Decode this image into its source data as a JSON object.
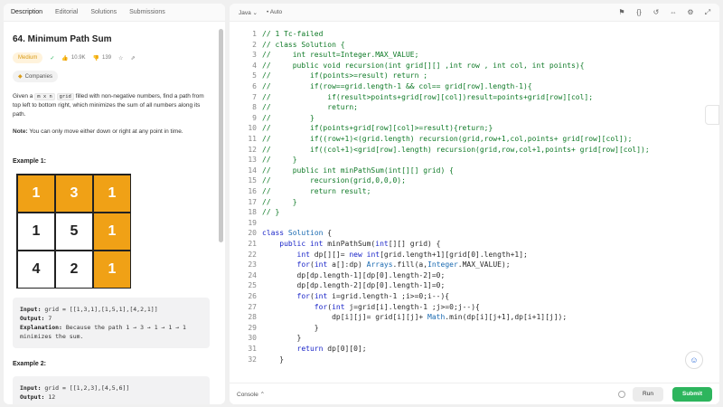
{
  "left_tabs": [
    "Description",
    "Editorial",
    "Solutions",
    "Submissions"
  ],
  "problem": {
    "title": "64. Minimum Path Sum",
    "difficulty": "Medium",
    "difficulty_color": "#d99b18",
    "likes": "10.9K",
    "dislikes": "139",
    "companies": "Companies",
    "desc_prefix": "Given a",
    "desc_code": "m x n",
    "desc_code2": "grid",
    "desc_rest": "filled with non-negative numbers, find a path from top left to bottom right, which minimizes the sum of all numbers along its path.",
    "note_label": "Note:",
    "note_text": "You can only move either down or right at any point in time."
  },
  "example1": {
    "label": "Example 1:",
    "grid": [
      [
        "1",
        "3",
        "1"
      ],
      [
        "1",
        "5",
        "1"
      ],
      [
        "4",
        "2",
        "1"
      ]
    ],
    "path_color": "#f0a116",
    "input_label": "Input:",
    "input_value": "grid = [[1,3,1],[1,5,1],[4,2,1]]",
    "output_label": "Output:",
    "output_value": "7",
    "explanation_label": "Explanation:",
    "explanation_value": "Because the path 1 → 3 → 1 → 1 → 1 minimizes the sum."
  },
  "example2": {
    "label": "Example 2:",
    "input_label": "Input:",
    "input_value": "grid = [[1,2,3],[4,5,6]]",
    "output_label": "Output:",
    "output_value": "12"
  },
  "editor": {
    "language": "Java",
    "autocomplete": "Auto",
    "lines": [
      {
        "n": "1",
        "t": "// 1 Tc-failed",
        "c": "cm"
      },
      {
        "n": "2",
        "t": "// class Solution {",
        "c": "cm"
      },
      {
        "n": "3",
        "t": "//     int result=Integer.MAX_VALUE;",
        "c": "cm"
      },
      {
        "n": "4",
        "t": "//     public void recursion(int grid[][] ,int row , int col, int points){",
        "c": "cm"
      },
      {
        "n": "5",
        "t": "//         if(points>=result) return ;",
        "c": "cm"
      },
      {
        "n": "6",
        "t": "//         if(row==grid.length-1 && col== grid[row].length-1){",
        "c": "cm"
      },
      {
        "n": "7",
        "t": "//             if(result>points+grid[row][col])result=points+grid[row][col];",
        "c": "cm"
      },
      {
        "n": "8",
        "t": "//             return;",
        "c": "cm"
      },
      {
        "n": "9",
        "t": "//         }",
        "c": "cm"
      },
      {
        "n": "10",
        "t": "//         if(points+grid[row][col]>=result){return;}",
        "c": "cm"
      },
      {
        "n": "11",
        "t": "//         if((row+1)<(grid.length) recursion(grid,row+1,col,points+ grid[row][col]);",
        "c": "cm"
      },
      {
        "n": "12",
        "t": "//         if((col+1)<grid[row].length) recursion(grid,row,col+1,points+ grid[row][col]);",
        "c": "cm"
      },
      {
        "n": "13",
        "t": "//     }",
        "c": "cm"
      },
      {
        "n": "14",
        "t": "//     public int minPathSum(int[][] grid) {",
        "c": "cm"
      },
      {
        "n": "15",
        "t": "//         recursion(grid,0,0,0);",
        "c": "cm"
      },
      {
        "n": "16",
        "t": "//         return result;",
        "c": "cm"
      },
      {
        "n": "17",
        "t": "//     }",
        "c": "cm"
      },
      {
        "n": "18",
        "t": "// }",
        "c": "cm"
      },
      {
        "n": "19",
        "t": "",
        "c": "pl"
      },
      {
        "n": "20",
        "t": "class Solution {",
        "c": "code"
      },
      {
        "n": "21",
        "t": "    public int minPathSum(int[][] grid) {",
        "c": "code"
      },
      {
        "n": "22",
        "t": "        int dp[][]= new int[grid.length+1][grid[0].length+1];",
        "c": "code"
      },
      {
        "n": "23",
        "t": "        for(int a[]:dp) Arrays.fill(a,Integer.MAX_VALUE);",
        "c": "code"
      },
      {
        "n": "24",
        "t": "        dp[dp.length-1][dp[0].length-2]=0;",
        "c": "code"
      },
      {
        "n": "25",
        "t": "        dp[dp.length-2][dp[0].length-1]=0;",
        "c": "code"
      },
      {
        "n": "26",
        "t": "        for(int i=grid.length-1 ;i>=0;i--){",
        "c": "code"
      },
      {
        "n": "27",
        "t": "            for(int j=grid[i].length-1 ;j>=0;j--){",
        "c": "code"
      },
      {
        "n": "28",
        "t": "                dp[i][j]= grid[i][j]+ Math.min(dp[i][j+1],dp[i+1][j]);",
        "c": "code"
      },
      {
        "n": "29",
        "t": "            }",
        "c": "code"
      },
      {
        "n": "30",
        "t": "        }",
        "c": "code"
      },
      {
        "n": "31",
        "t": "        return dp[0][0];",
        "c": "code"
      },
      {
        "n": "32",
        "t": "    }",
        "c": "code"
      }
    ]
  },
  "bottom": {
    "console": "Console",
    "run": "Run",
    "submit": "Submit",
    "submit_color": "#2db55d"
  }
}
